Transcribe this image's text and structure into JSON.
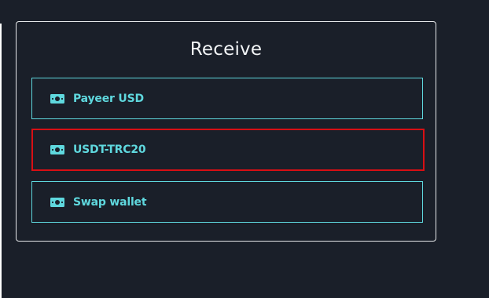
{
  "panel": {
    "title": "Receive"
  },
  "options": [
    {
      "label": "Payeer USD",
      "icon": "money-bill-icon",
      "selected": false
    },
    {
      "label": "USDT-TRC20",
      "icon": "money-bill-icon",
      "selected": true
    },
    {
      "label": "Swap wallet",
      "icon": "money-bill-icon",
      "selected": false
    }
  ],
  "colors": {
    "background": "#1a1f29",
    "accent": "#5fd8de",
    "selection_highlight": "#d80f14",
    "title": "#f2f4f6"
  }
}
